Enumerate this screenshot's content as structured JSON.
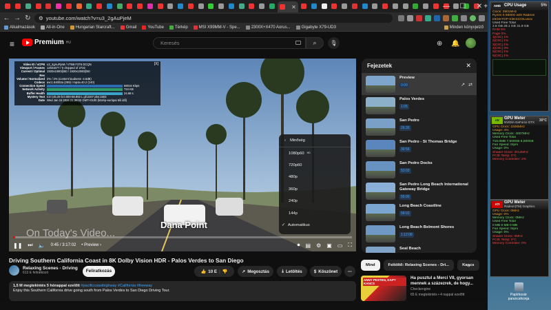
{
  "browser": {
    "tab_colors": [
      "#e33",
      "#e33",
      "#4a8",
      "#e33",
      "#d33",
      "#e3a",
      "#e33",
      "#e63",
      "#3a8",
      "#e33",
      "#28c",
      "#4a6",
      "#e33",
      "#e33",
      "#d3a",
      "#e33",
      "#999",
      "#28c",
      "#e33",
      "#999",
      "#3c3",
      "#999",
      "#28c",
      "#4a8",
      "#e33",
      "#999",
      "#2a6",
      "#e33",
      "#28c",
      "#eee",
      "#e33",
      "#999",
      "#d33",
      "#28c",
      "#999",
      "#e33",
      "#999",
      "#999",
      "#3a3",
      "#999",
      "#e33",
      "#e33",
      "#999",
      "#3a3",
      "#d33"
    ],
    "url": "youtube.com/watch?v=u3_2gAuPjeM",
    "bookmarks": [
      {
        "label": "Alkalmazások",
        "color": "#69c"
      },
      {
        "label": "All-in-One",
        "color": "#aaa"
      },
      {
        "label": "Hungarian Starcraft...",
        "color": "#c93"
      },
      {
        "label": "Gmail",
        "color": "#e33"
      },
      {
        "label": "YouTube",
        "color": "#e22"
      },
      {
        "label": "Térkép",
        "color": "#4a4"
      },
      {
        "label": "MSI X99MM-V - Spe...",
        "color": "#d33"
      },
      {
        "label": "2300X+X470 Aorus...",
        "color": "#888"
      },
      {
        "label": "Gigabyte X79-UD3",
        "color": "#888"
      }
    ],
    "other_bookmarks": "Minden könyvjelző"
  },
  "youtube": {
    "logo": "Premium",
    "logo_sup": "HU",
    "search_placeholder": "Keresés",
    "stats": [
      {
        "k": "Video ID / sCPN",
        "v": "u3_2gAuPjeM / VTB6 F3T6 DCQN"
      },
      {
        "k": "Viewport / Frames",
        "v": "1202x677 / 0 dropped of 2722"
      },
      {
        "k": "Current / Optimal Res",
        "v": "1920x1080@60 / 1920x1080@60"
      },
      {
        "k": "Volume / Normalized",
        "v": "2% / 2% (content loudness -4.6dB)"
      },
      {
        "k": "Codecs",
        "v": "avc1.64002a (299) / mp4a.40.2 (140)"
      },
      {
        "k": "Connection Speed",
        "v": "68016 Kbps"
      },
      {
        "k": "Network Activity",
        "v": "724 KB"
      },
      {
        "k": "Buffer Health",
        "v": "24.68 s"
      },
      {
        "k": "Mystery Text",
        "v": "s:8 t:45.29 b:0.000-69.892 L gll:2207 pbs:1503"
      },
      {
        "k": "Date",
        "v": "Wed Jan 24 2024 21:39:02 GMT+0100 (közép-európai téli idő)"
      }
    ],
    "stats_close": "[X]",
    "watermark": "On Today's Video...",
    "location": "Dana Point",
    "time": "0:45 / 3:17:02",
    "chapter_label": "Preview",
    "quality_menu": {
      "header": "Minőség",
      "options": [
        {
          "label": "1080p60",
          "badge": "HD",
          "selected": false
        },
        {
          "label": "720p60",
          "badge": "",
          "selected": false
        },
        {
          "label": "480p",
          "badge": "",
          "selected": false
        },
        {
          "label": "360p",
          "badge": "",
          "selected": false
        },
        {
          "label": "240p",
          "badge": "",
          "selected": false
        },
        {
          "label": "144p",
          "badge": "",
          "selected": false
        },
        {
          "label": "Automatikus",
          "badge": "",
          "selected": true
        }
      ]
    },
    "chapters": {
      "title": "Fejezetek",
      "items": [
        {
          "title": "Preview",
          "time": "0:00",
          "active": true,
          "color": "#7ea6cc"
        },
        {
          "title": "Palos Verdes",
          "time": "1:05",
          "active": false,
          "color": "#8cb0c8"
        },
        {
          "title": "San Pedro",
          "time": "26:35",
          "active": false,
          "color": "#7aa0c8"
        },
        {
          "title": "San Pedro - St Thomas Bridge",
          "time": "30:56",
          "active": false,
          "color": "#5a86bd"
        },
        {
          "title": "San Pedro Docks",
          "time": "53:03",
          "active": false,
          "color": "#6892c0"
        },
        {
          "title": "San Pedro Long Beach International Gateway Bridge",
          "time": "55:00",
          "active": false,
          "color": "#8ab0d8"
        },
        {
          "title": "Long Beach Coastline",
          "time": "58:03",
          "active": false,
          "color": "#7ba6d0"
        },
        {
          "title": "Long Beach Belmont Shores",
          "time": "1:12:08",
          "active": false,
          "color": "#6f99c4"
        },
        {
          "title": "Seal Beach",
          "time": "",
          "active": false,
          "color": "#7fa3c6"
        }
      ]
    },
    "video_title": "Driving Southern California Coast in 8K Dolby Vision HDR - Palos Verdes to San Diego",
    "channel_name": "Relaxing Scenes - Driving",
    "channel_subs": "613 E feliratkozó",
    "subscribe": "Feliratkozás",
    "likes": "10 E",
    "share": "Megosztás",
    "download": "Letöltés",
    "thanks": "Köszönet",
    "description": {
      "meta": "1,5 M megtekintés  5 hónappal ezelőtt",
      "tags": "#pacificcoasthighway #California #freeway",
      "text": "Enjoy this Southern California drive going south from Palos Verdes to San Diego Driving Tour."
    },
    "filters": [
      "Mind",
      "Feltöltő: Relaxing Scenes - Dri...",
      "Kapcs"
    ],
    "recommended": {
      "thumb_label": "ANNY PESTEN, KAPY KANCS",
      "title": "Ha pusztul a Merci V8, gyorsan mennek a százezrek, de hogy...",
      "channel": "Checkengine",
      "meta": "65 E megtekintés • 4 nappal ezelőtt"
    }
  },
  "gadgets": {
    "cpu": {
      "title": "CPU Usage",
      "pct": "5%",
      "logo": "AMD",
      "lines": [
        "Clock: 3901MHz",
        "Ryzen 5 5600G with Radeon",
        "DESKTOP-S3KSCO\\Lukov",
        "Used Free Total",
        "2.8 GB 29.1 GB 31.9 GB"
      ],
      "cores": [
        "RAM 9%",
        "Page 0%",
        "1[C0C] 1%",
        "2[C0C] 1%",
        "3[C0C] 1%",
        "4[C0C] 3%",
        "5[C0C] 1%",
        "6[C0C] 1%"
      ]
    },
    "gpu1": {
      "title": "GPU Meter",
      "sub": "NVIDIA GeForce GTX",
      "lines": [
        "GPU Clock: 1506MHz",
        "Usage: 4%",
        "Memory Clock: 4007MHz",
        "Used Free Total",
        "716.0MB 7,500GB 8,000GB",
        "Fan Speed: 0rpm",
        "Usage: 0%",
        "Shader Clock: 3012MHz",
        "PCIE Temp: 0°C",
        "Memory Controller: 2%"
      ],
      "temp": "30°C"
    },
    "gpu2": {
      "title": "GPU Meter",
      "sub": "Radeon(TM) Graphics",
      "lines": [
        "GPU Clock: 0MHz",
        "Usage: 0%",
        "Memory Clock: 0MHz",
        "Used Free Total",
        "0 MB 0 MB 0 MB",
        "Fan Speed: 0rpm",
        "Usage: 0%",
        "Shader Clock: 0MHz",
        "PCIE Temp: 0°C",
        "Memory Controller: 0%"
      ]
    },
    "recycle_label": "Papírkosár parancsikonja"
  }
}
